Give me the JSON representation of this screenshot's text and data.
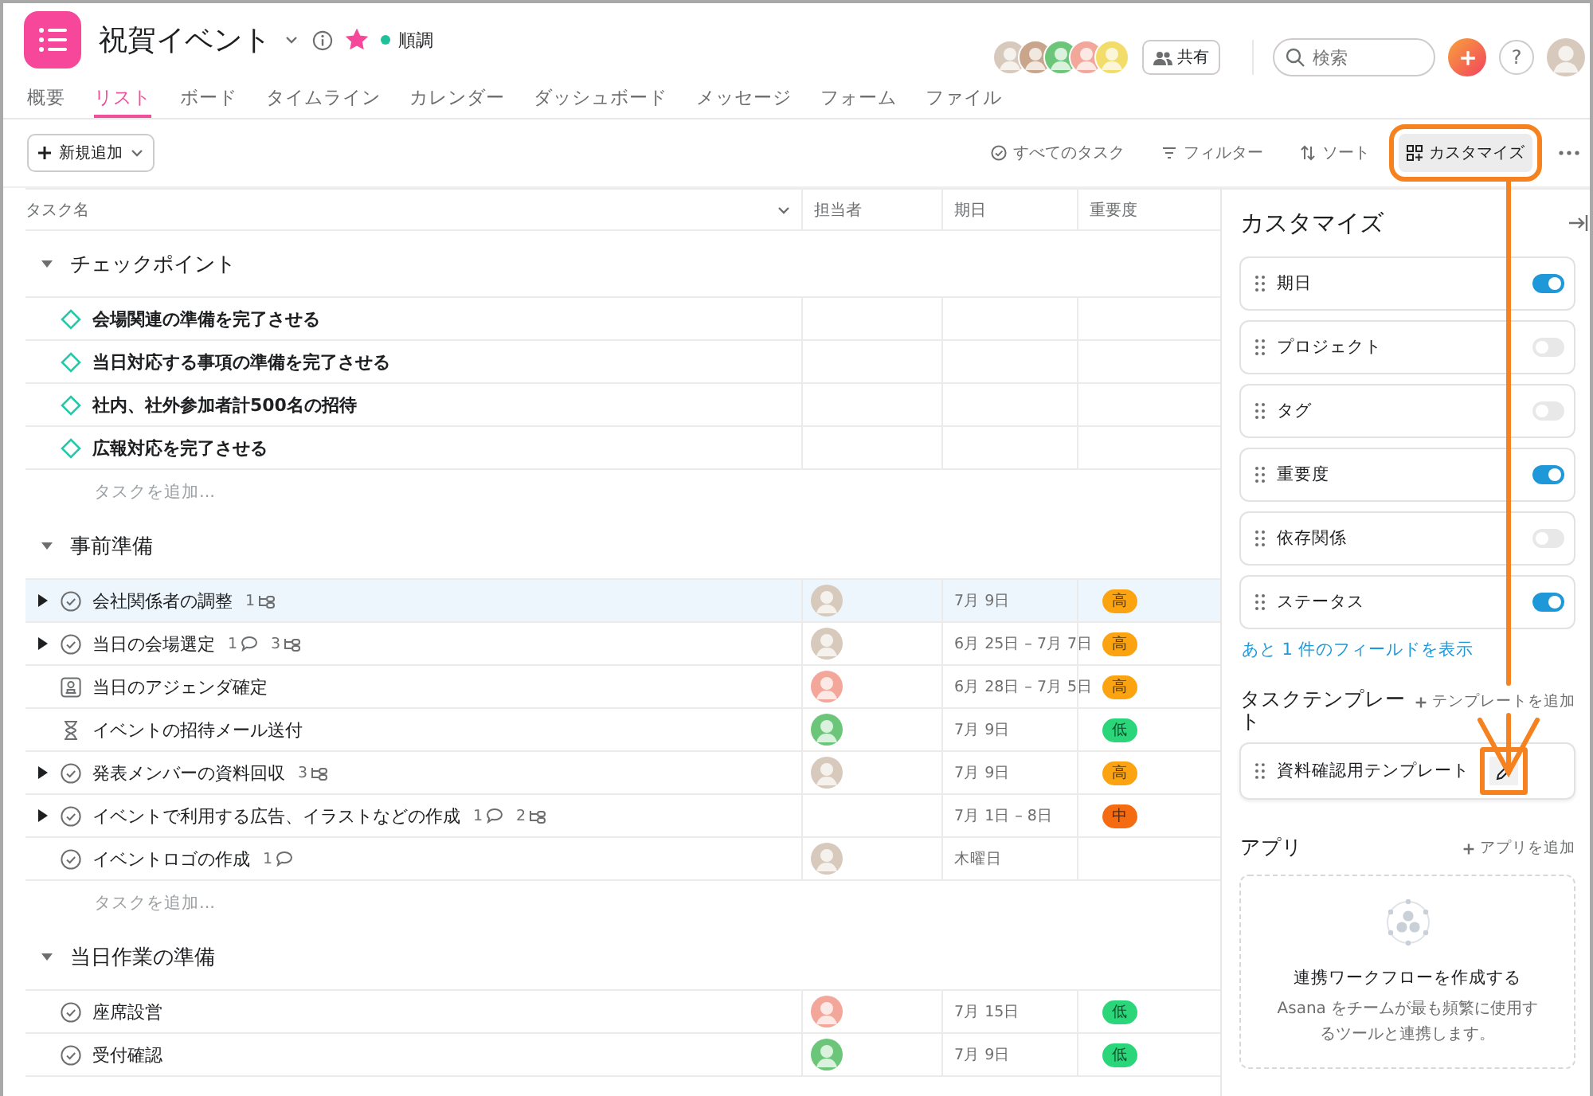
{
  "project": {
    "title": "祝賀イベント",
    "starred": true,
    "status": {
      "label": "順調",
      "color": "#1fc19a"
    }
  },
  "members": [
    {
      "color": "#d8c9bd"
    },
    {
      "color": "#c9a58c"
    },
    {
      "color": "#6cc67a"
    },
    {
      "color": "#f3a79a"
    },
    {
      "color": "#f2dc6a"
    }
  ],
  "share_button": "共有",
  "search": {
    "placeholder": "検索"
  },
  "help_button": "?",
  "current_user": {
    "color": "#d8c9bd"
  },
  "tabs": [
    {
      "label": "概要",
      "selected": false
    },
    {
      "label": "リスト",
      "selected": true
    },
    {
      "label": "ボード",
      "selected": false
    },
    {
      "label": "タイムライン",
      "selected": false
    },
    {
      "label": "カレンダー",
      "selected": false
    },
    {
      "label": "ダッシュボード",
      "selected": false
    },
    {
      "label": "メッセージ",
      "selected": false
    },
    {
      "label": "フォーム",
      "selected": false
    },
    {
      "label": "ファイル",
      "selected": false
    }
  ],
  "toolbar": {
    "new_button": "新規追加",
    "actions": [
      {
        "label": "すべてのタスク",
        "kind": "completion",
        "highlighted": false
      },
      {
        "label": "フィルター",
        "kind": "filter",
        "highlighted": false
      },
      {
        "label": "ソート",
        "kind": "sort",
        "highlighted": false
      },
      {
        "label": "カスタマイズ",
        "kind": "customize",
        "highlighted": true
      }
    ]
  },
  "table": {
    "columns": [
      "タスク名",
      "担当者",
      "期日",
      "重要度"
    ]
  },
  "sections": [
    {
      "title": "チェックポイント",
      "expanded": true,
      "add_task": "タスクを追加...",
      "tasks": [
        {
          "name": "会場関連の準備を完了させる",
          "kind": "milestone",
          "selected": false,
          "expandable": false
        },
        {
          "name": "当日対応する事項の準備を完了させる",
          "kind": "milestone",
          "selected": false,
          "expandable": false
        },
        {
          "name": "社内、社外参加者計500名の招待",
          "kind": "milestone",
          "selected": false,
          "expandable": false
        },
        {
          "name": "広報対応を完了させる",
          "kind": "milestone",
          "selected": false,
          "expandable": false
        }
      ]
    },
    {
      "title": "事前準備",
      "expanded": true,
      "add_task": "タスクを追加...",
      "tasks": [
        {
          "name": "会社関係者の調整",
          "kind": "task",
          "selected": true,
          "expandable": true,
          "subtasks": "1",
          "assignee": {
            "color": "#d8c9bd"
          },
          "due": "7月 9日",
          "priority": {
            "label": "高",
            "color": "#fca311"
          }
        },
        {
          "name": "当日の会場選定",
          "kind": "task",
          "selected": false,
          "expandable": true,
          "comments": "1",
          "subtasks": "3",
          "assignee": {
            "color": "#d8c9bd"
          },
          "due": "6月 25日 – 7月 7日",
          "priority": {
            "label": "高",
            "color": "#fca311"
          }
        },
        {
          "name": "当日のアジェンダ確定",
          "kind": "approval",
          "selected": false,
          "expandable": false,
          "assignee": {
            "color": "#f3a79a"
          },
          "due": "6月 28日 – 7月 5日",
          "priority": {
            "label": "高",
            "color": "#fca311"
          }
        },
        {
          "name": "イベントの招待メール送付",
          "kind": "waiting",
          "selected": false,
          "expandable": false,
          "assignee": {
            "color": "#6cc67a"
          },
          "due": "7月 9日",
          "priority": {
            "label": "低",
            "color": "#2bd67b"
          }
        },
        {
          "name": "発表メンバーの資料回収",
          "kind": "task",
          "selected": false,
          "expandable": true,
          "subtasks": "3",
          "assignee": {
            "color": "#d8c9bd"
          },
          "due": "7月 9日",
          "priority": {
            "label": "高",
            "color": "#fca311"
          }
        },
        {
          "name": "イベントで利用する広告、イラストなどの作成",
          "kind": "task",
          "selected": false,
          "expandable": true,
          "comments": "1",
          "subtasks": "2",
          "due": "7月 1日 – 8日",
          "priority": {
            "label": "中",
            "color": "#f56b12"
          }
        },
        {
          "name": "イベントロゴの作成",
          "kind": "task",
          "selected": false,
          "expandable": false,
          "comments": "1",
          "assignee": {
            "color": "#d8c9bd"
          },
          "due": "木曜日"
        }
      ]
    },
    {
      "title": "当日作業の準備",
      "expanded": true,
      "tasks": [
        {
          "name": "座席設営",
          "kind": "task",
          "selected": false,
          "expandable": false,
          "assignee": {
            "color": "#f3a79a"
          },
          "due": "7月 15日",
          "priority": {
            "label": "低",
            "color": "#2bd67b"
          }
        },
        {
          "name": "受付確認",
          "kind": "task",
          "selected": false,
          "expandable": false,
          "assignee": {
            "color": "#6cc67a"
          },
          "due": "7月 9日",
          "priority": {
            "label": "低",
            "color": "#2bd67b"
          }
        }
      ]
    }
  ],
  "customize": {
    "title": "カスタマイズ",
    "fields": [
      {
        "label": "期日",
        "on": true
      },
      {
        "label": "プロジェクト",
        "on": false
      },
      {
        "label": "タグ",
        "on": false
      },
      {
        "label": "重要度",
        "on": true
      },
      {
        "label": "依存関係",
        "on": false
      },
      {
        "label": "ステータス",
        "on": true
      }
    ],
    "more_fields_link": "あと 1 件のフィールドを表示",
    "templates": {
      "title": "タスクテンプレート",
      "add": "テンプレートを追加",
      "items": [
        {
          "name": "資料確認用テンプレート",
          "highlighted": true
        }
      ]
    },
    "apps": {
      "title": "アプリ",
      "add": "アプリを追加",
      "empty_title": "連携ワークフローを作成する",
      "empty_text": "Asana をチームが最も頻繁に使用するツールと連携します。"
    }
  }
}
